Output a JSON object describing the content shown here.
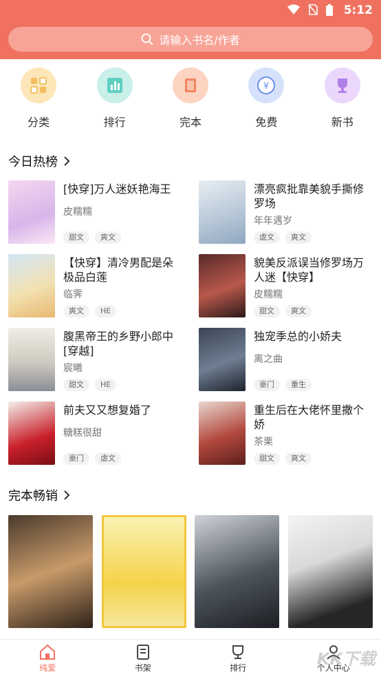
{
  "status": {
    "time": "5:12"
  },
  "search": {
    "placeholder": "请输入书名/作者"
  },
  "categories": [
    {
      "label": "分类",
      "icon": "grid-icon",
      "color": "#fde6b8"
    },
    {
      "label": "排行",
      "icon": "chart-icon",
      "color": "#c9efe9"
    },
    {
      "label": "完本",
      "icon": "book-icon",
      "color": "#fdd3c1"
    },
    {
      "label": "免费",
      "icon": "free-icon",
      "color": "#d6e2fb"
    },
    {
      "label": "新书",
      "icon": "trophy-icon",
      "color": "#ead7fb"
    }
  ],
  "sections": {
    "hot": "今日热榜",
    "finished": "完本畅销"
  },
  "books": [
    {
      "title": "[快穿]万人迷妖艳海王",
      "author": "皮糯糯",
      "tags": [
        "甜文",
        "爽文"
      ]
    },
    {
      "title": "漂亮疯批靠美貌手撕修罗场",
      "author": "年年遇岁",
      "tags": [
        "虐文",
        "爽文"
      ]
    },
    {
      "title": "【快穿】清冷男配是朵极品白莲",
      "author": "临霁",
      "tags": [
        "爽文",
        "HE"
      ]
    },
    {
      "title": "貌美反派误当修罗场万人迷【快穿】",
      "author": "皮糯糯",
      "tags": [
        "甜文",
        "爽文"
      ]
    },
    {
      "title": "腹黑帝王的乡野小郎中[穿越]",
      "author": "宸曦",
      "tags": [
        "甜文",
        "HE"
      ]
    },
    {
      "title": "独宠季总的小娇夫",
      "author": "离之曲",
      "tags": [
        "豪门",
        "重生"
      ]
    },
    {
      "title": "前夫又又想复婚了",
      "author": "糖糕很甜",
      "tags": [
        "豪门",
        "虐文"
      ]
    },
    {
      "title": "重生后在大佬怀里撒个娇",
      "author": "茶栗",
      "tags": [
        "甜文",
        "爽文"
      ]
    }
  ],
  "tabs": [
    {
      "label": "纯爱",
      "icon": "home-icon"
    },
    {
      "label": "书架",
      "icon": "bookshelf-icon"
    },
    {
      "label": "排行",
      "icon": "rank-icon"
    },
    {
      "label": "个人中心",
      "icon": "profile-icon"
    }
  ],
  "watermark": "KK下载",
  "colors": {
    "accent": "#f07160"
  }
}
